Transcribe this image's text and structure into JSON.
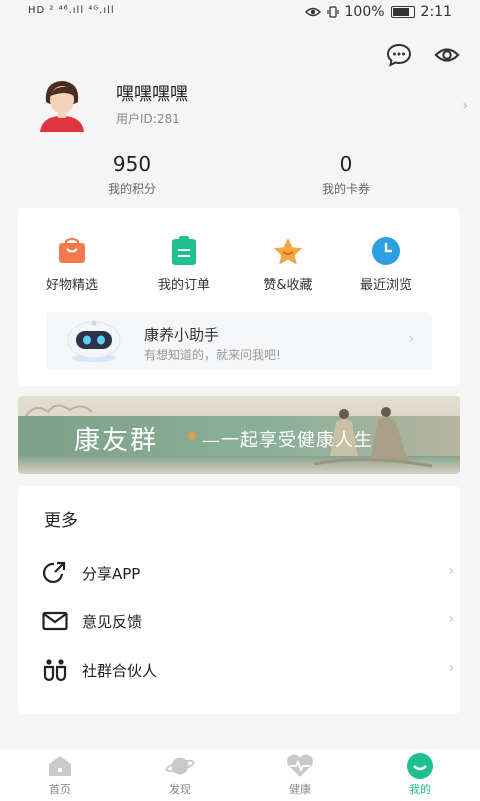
{
  "status_bar": {
    "left": "HD ² ⁴⁶.ıll ⁴ᴳ.ıll",
    "battery": "100%",
    "time": "2:11"
  },
  "profile": {
    "name": "嘿嘿嘿嘿",
    "user_id": "用户ID:281"
  },
  "stats": [
    {
      "value": "950",
      "label": "我的积分"
    },
    {
      "value": "0",
      "label": "我的卡券"
    }
  ],
  "quick_links": [
    {
      "label": "好物精选",
      "icon": "shopping-bag-icon",
      "color": "#f47a4e"
    },
    {
      "label": "我的订单",
      "icon": "clipboard-icon",
      "color": "#22c08f"
    },
    {
      "label": "赞&收藏",
      "icon": "star-icon",
      "color": "#f6a63b"
    },
    {
      "label": "最近浏览",
      "icon": "clock-icon",
      "color": "#2e9fe0"
    }
  ],
  "assistant": {
    "title": "康养小助手",
    "subtitle": "有想知道的，就来问我吧!"
  },
  "banner": {
    "title": "康友群",
    "subtitle": "一起享受健康人生"
  },
  "more": {
    "title": "更多",
    "items": [
      {
        "label": "分享APP",
        "icon": "share-icon"
      },
      {
        "label": "意见反馈",
        "icon": "mail-icon"
      },
      {
        "label": "社群合伙人",
        "icon": "partners-icon"
      }
    ]
  },
  "tabs": [
    {
      "label": "首页",
      "icon": "home-icon"
    },
    {
      "label": "发现",
      "icon": "planet-icon"
    },
    {
      "label": "健康",
      "icon": "heart-pulse-icon"
    },
    {
      "label": "我的",
      "icon": "smile-icon"
    }
  ],
  "colors": {
    "accent": "#1fbf8f",
    "background": "#f5f5f5"
  }
}
